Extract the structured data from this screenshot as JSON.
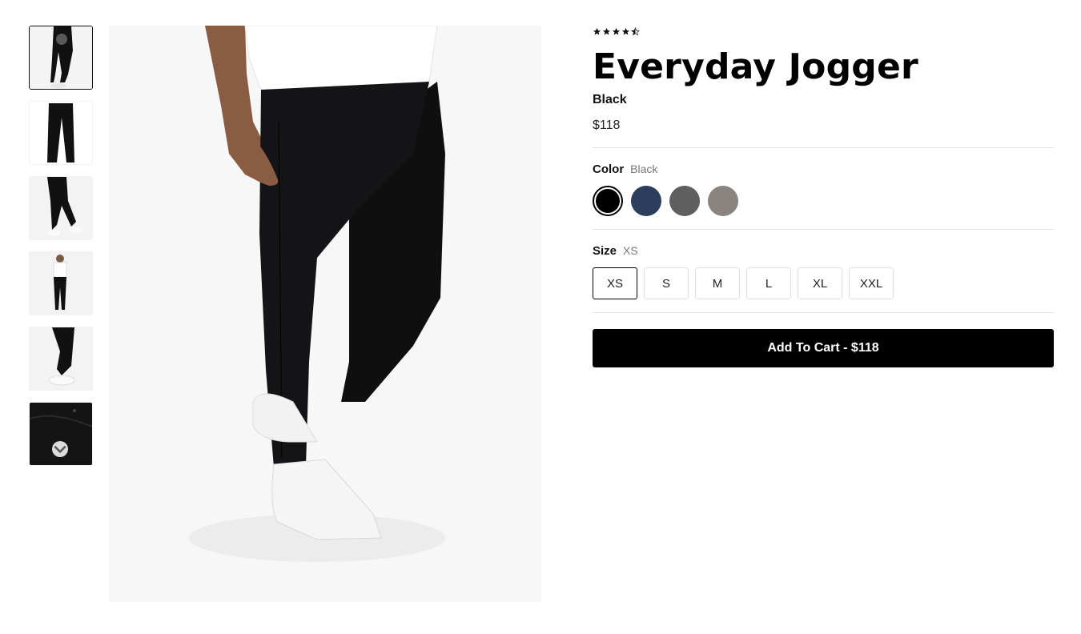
{
  "product": {
    "rating": 4.5,
    "rating_max": 5,
    "title": "Everyday Jogger",
    "color_name": "Black",
    "price": "$118"
  },
  "color": {
    "label": "Color",
    "selected": "Black",
    "swatches": [
      {
        "name": "Black",
        "hex": "#000000"
      },
      {
        "name": "Navy",
        "hex": "#2c3e5c"
      },
      {
        "name": "Charcoal",
        "hex": "#5f5f60"
      },
      {
        "name": "Taupe",
        "hex": "#8a8480"
      }
    ]
  },
  "size": {
    "label": "Size",
    "selected": "XS",
    "options": [
      "XS",
      "S",
      "M",
      "L",
      "XL",
      "XXL"
    ]
  },
  "cart": {
    "label": "Add To Cart - $118"
  },
  "gallery": {
    "thumbnail_count": 6,
    "selected_index": 0,
    "scroll_icon": "chevron-down-icon"
  },
  "colors": {
    "accent": "#000000",
    "divider": "#e3e3e3",
    "muted_text": "#777777"
  }
}
